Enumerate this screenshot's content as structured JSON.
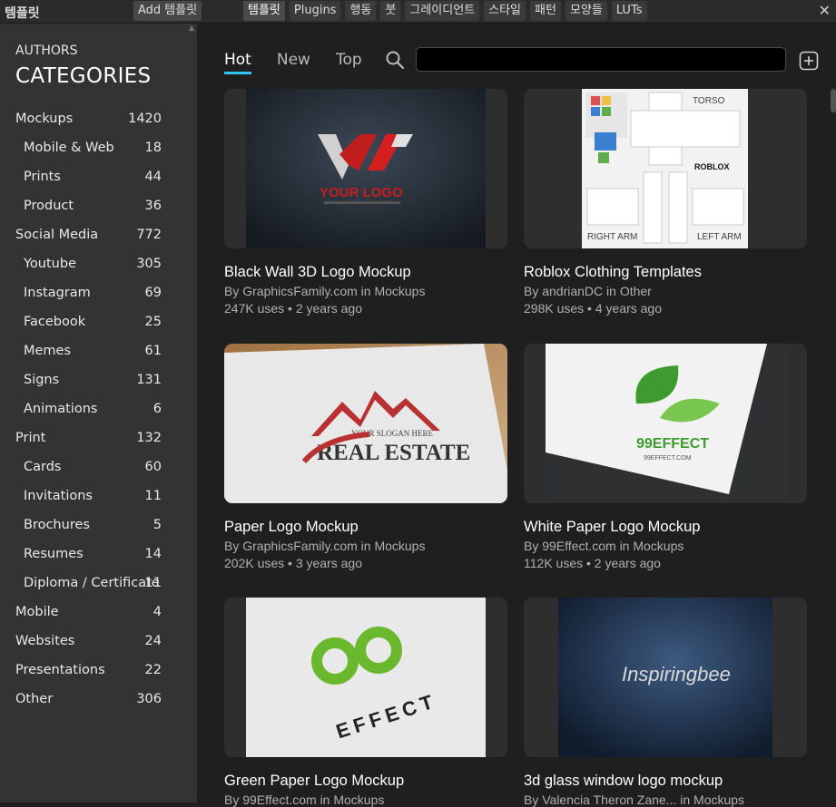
{
  "topbar": {
    "panel_title": "템플릿",
    "add_button": "Add 템플릿",
    "tabs": [
      {
        "label": "템플릿",
        "active": true
      },
      {
        "label": "Plugins",
        "active": false
      },
      {
        "label": "행동",
        "active": false
      },
      {
        "label": "붓",
        "active": false
      },
      {
        "label": "그레이디언트",
        "active": false
      },
      {
        "label": "스타일",
        "active": false
      },
      {
        "label": "패턴",
        "active": false
      },
      {
        "label": "모양들",
        "active": false
      },
      {
        "label": "LUTs",
        "active": false
      }
    ],
    "close_glyph": "✕"
  },
  "sidebar": {
    "authors_label": "AUTHORS",
    "categories_label": "CATEGORIES",
    "items": [
      {
        "label": "Mockups",
        "count": "1420",
        "sub": false
      },
      {
        "label": "Mobile & Web",
        "count": "18",
        "sub": true
      },
      {
        "label": "Prints",
        "count": "44",
        "sub": true
      },
      {
        "label": "Product",
        "count": "36",
        "sub": true
      },
      {
        "label": "Social Media",
        "count": "772",
        "sub": false
      },
      {
        "label": "Youtube",
        "count": "305",
        "sub": true
      },
      {
        "label": "Instagram",
        "count": "69",
        "sub": true
      },
      {
        "label": "Facebook",
        "count": "25",
        "sub": true
      },
      {
        "label": "Memes",
        "count": "61",
        "sub": true
      },
      {
        "label": "Signs",
        "count": "131",
        "sub": true
      },
      {
        "label": "Animations",
        "count": "6",
        "sub": true
      },
      {
        "label": "Print",
        "count": "132",
        "sub": false
      },
      {
        "label": "Cards",
        "count": "60",
        "sub": true
      },
      {
        "label": "Invitations",
        "count": "11",
        "sub": true
      },
      {
        "label": "Brochures",
        "count": "5",
        "sub": true
      },
      {
        "label": "Resumes",
        "count": "14",
        "sub": true
      },
      {
        "label": "Diploma / Certificate",
        "count": "11",
        "sub": true
      },
      {
        "label": "Mobile",
        "count": "4",
        "sub": false
      },
      {
        "label": "Websites",
        "count": "24",
        "sub": false
      },
      {
        "label": "Presentations",
        "count": "22",
        "sub": false
      },
      {
        "label": "Other",
        "count": "306",
        "sub": false
      }
    ]
  },
  "main": {
    "sort_tabs": [
      {
        "label": "Hot",
        "active": true
      },
      {
        "label": "New",
        "active": false
      },
      {
        "label": "Top",
        "active": false
      }
    ],
    "search": {
      "value": "",
      "placeholder": ""
    },
    "accent_color": "#31c6f0",
    "cards": [
      {
        "title": "Black Wall 3D Logo Mockup",
        "byline": "By GraphicsFamily.com in Mockups",
        "stats": "247K uses • 2 years ago",
        "thumb_text": "YOUR LOGO"
      },
      {
        "title": "Roblox Clothing Templates",
        "byline": "By andrianDC in Other",
        "stats": "298K uses • 4 years ago",
        "thumb_text": "ROBLOX",
        "thumb_labels": [
          "TORSO",
          "RIGHT ARM",
          "LEFT ARM"
        ]
      },
      {
        "title": "Paper Logo Mockup",
        "byline": "By GraphicsFamily.com in Mockups",
        "stats": "202K uses • 3 years ago",
        "thumb_text": "REAL ESTATE",
        "thumb_sub": "YOUR SLOGAN HERE"
      },
      {
        "title": "White Paper Logo Mockup",
        "byline": "By 99Effect.com in Mockups",
        "stats": "112K uses • 2 years ago",
        "thumb_text": "99EFFECT",
        "thumb_sub": "99EFFECT.COM"
      },
      {
        "title": "Green Paper Logo Mockup",
        "byline": "By 99Effect.com in Mockups",
        "stats": "",
        "thumb_text": "EFFECT"
      },
      {
        "title": "3d glass window logo mockup",
        "byline": "By Valencia Theron Zane... in Mockups",
        "stats": "",
        "thumb_text": "Inspiringbee"
      }
    ]
  }
}
